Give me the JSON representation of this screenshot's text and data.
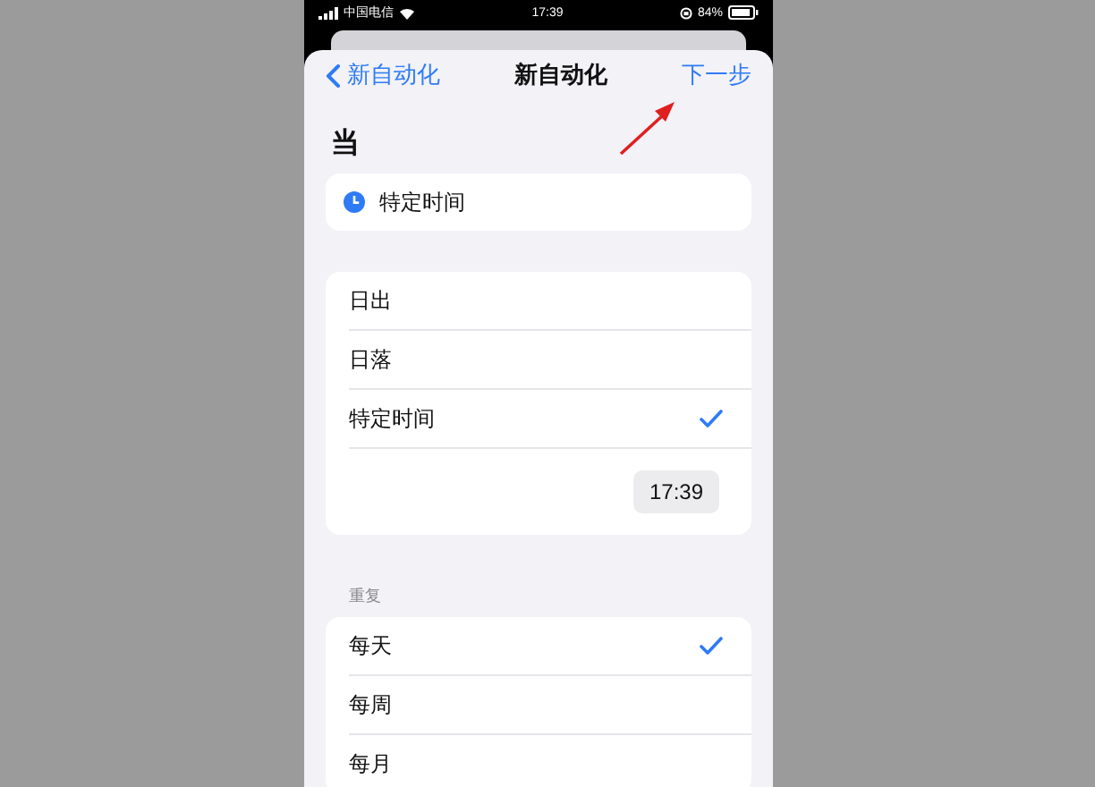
{
  "status_bar": {
    "carrier": "中国电信",
    "time": "17:39",
    "battery": "84%"
  },
  "nav": {
    "back_label": "新自动化",
    "title": "新自动化",
    "action": "下一步"
  },
  "trigger": {
    "section_title": "当",
    "summary": "特定时间"
  },
  "options": [
    {
      "label": "日出",
      "selected": false
    },
    {
      "label": "日落",
      "selected": false
    },
    {
      "label": "特定时间",
      "selected": true
    }
  ],
  "time_value": "17:39",
  "repeat": {
    "section_title": "重复",
    "options": [
      {
        "label": "每天",
        "selected": true
      },
      {
        "label": "每周",
        "selected": false
      },
      {
        "label": "每月",
        "selected": false
      }
    ]
  }
}
